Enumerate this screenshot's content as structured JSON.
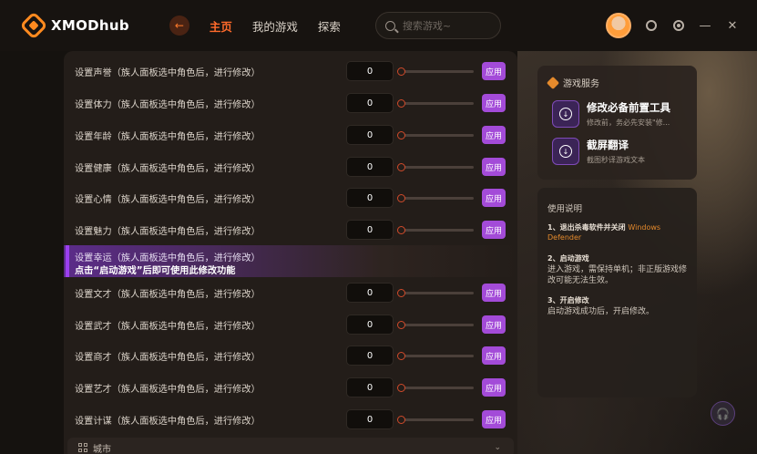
{
  "app": {
    "brand": "XMODhub"
  },
  "nav": {
    "back_glyph": "←",
    "items": [
      "主页",
      "我的游戏",
      "探索"
    ],
    "active": "主页"
  },
  "search": {
    "placeholder": "搜索游戏~"
  },
  "topbar": {
    "minimize": "—",
    "close": "✕"
  },
  "rows": [
    {
      "label": "设置声誉（族人面板选中角色后，进行修改）",
      "value": "0",
      "apply": "应用",
      "slider": 0
    },
    {
      "label": "设置体力（族人面板选中角色后，进行修改）",
      "value": "0",
      "apply": "应用",
      "slider": 0
    },
    {
      "label": "设置年龄（族人面板选中角色后，进行修改）",
      "value": "0",
      "apply": "应用",
      "slider": 0
    },
    {
      "label": "设置健康（族人面板选中角色后，进行修改）",
      "value": "0",
      "apply": "应用",
      "slider": 0
    },
    {
      "label": "设置心情（族人面板选中角色后，进行修改）",
      "value": "0",
      "apply": "应用",
      "slider": 0
    },
    {
      "label": "设置魅力（族人面板选中角色后，进行修改）",
      "value": "0",
      "apply": "应用",
      "slider": 0
    },
    {
      "label": "设置幸运（族人面板选中角色后，进行修改）",
      "locked_hint": "点击“启动游戏”后即可使用此修改功能"
    },
    {
      "label": "设置文才（族人面板选中角色后，进行修改）",
      "value": "0",
      "apply": "应用",
      "slider": 0
    },
    {
      "label": "设置武才（族人面板选中角色后，进行修改）",
      "value": "0",
      "apply": "应用",
      "slider": 0
    },
    {
      "label": "设置商才（族人面板选中角色后，进行修改）",
      "value": "0",
      "apply": "应用",
      "slider": 0
    },
    {
      "label": "设置艺才（族人面板选中角色后，进行修改）",
      "value": "0",
      "apply": "应用",
      "slider": 0
    },
    {
      "label": "设置计谋（族人面板选中角色后，进行修改）",
      "value": "0",
      "apply": "应用",
      "slider": 0
    }
  ],
  "footer_section": {
    "label": "城市",
    "chevron": "⌄"
  },
  "services": {
    "title": "游戏服务",
    "items": [
      {
        "name": "修改必备前置工具",
        "sub": "修改前，务必先安装\"修..."
      },
      {
        "name": "截屏翻译",
        "sub": "截图秒译游戏文本"
      }
    ]
  },
  "guide": {
    "title": "使用说明",
    "steps": [
      {
        "head": "1、退出杀毒软件并关闭",
        "highlight": "Windows Defender",
        "body": ""
      },
      {
        "head": "2、启动游戏",
        "highlight": "",
        "body": "进入游戏，需保持单机；非正版游戏修改可能无法生效。"
      },
      {
        "head": "3、开启修改",
        "highlight": "",
        "body": "启动游戏成功后，开启修改。"
      }
    ]
  },
  "help": {
    "glyph": "🎧"
  }
}
